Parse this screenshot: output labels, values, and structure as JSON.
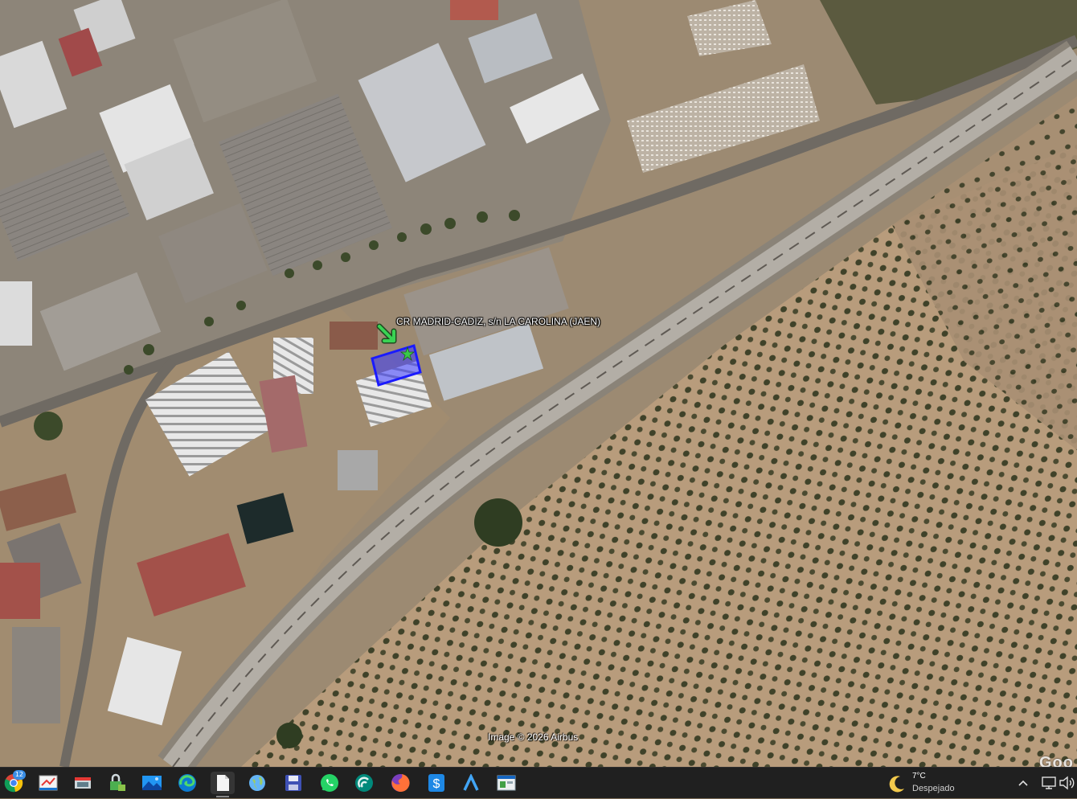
{
  "map": {
    "placemark_label": "CR MADRID-CADIZ, s/n LA CAROLINA (JAEN)",
    "copyright": "Image © 2026 Airbus",
    "logo_text": "Goo",
    "colors": {
      "highlight_outline": "#1a1aff",
      "highlight_fill": "#3a3aff",
      "arrow": "#39d353",
      "star": "#39c84a"
    }
  },
  "taskbar": {
    "apps": [
      {
        "name": "chrome-icon",
        "badge": "12"
      },
      {
        "name": "whiteboard-icon"
      },
      {
        "name": "camera-roll-icon"
      },
      {
        "name": "password-manager-icon"
      },
      {
        "name": "photos-icon"
      },
      {
        "name": "edge-icon"
      },
      {
        "name": "notepad-icon"
      },
      {
        "name": "globe-icon"
      },
      {
        "name": "save-disk-icon"
      },
      {
        "name": "whatsapp-icon"
      },
      {
        "name": "wifi-analyzer-icon"
      },
      {
        "name": "firefox-icon"
      },
      {
        "name": "dollar-app-icon"
      },
      {
        "name": "arrow-a-icon"
      },
      {
        "name": "window-app-icon"
      }
    ],
    "weather": {
      "temperature": "7°C",
      "condition": "Despejado",
      "icon": "moon-icon"
    },
    "tray": [
      {
        "name": "chevron-up-icon"
      },
      {
        "name": "network-icon"
      },
      {
        "name": "volume-icon"
      }
    ]
  }
}
